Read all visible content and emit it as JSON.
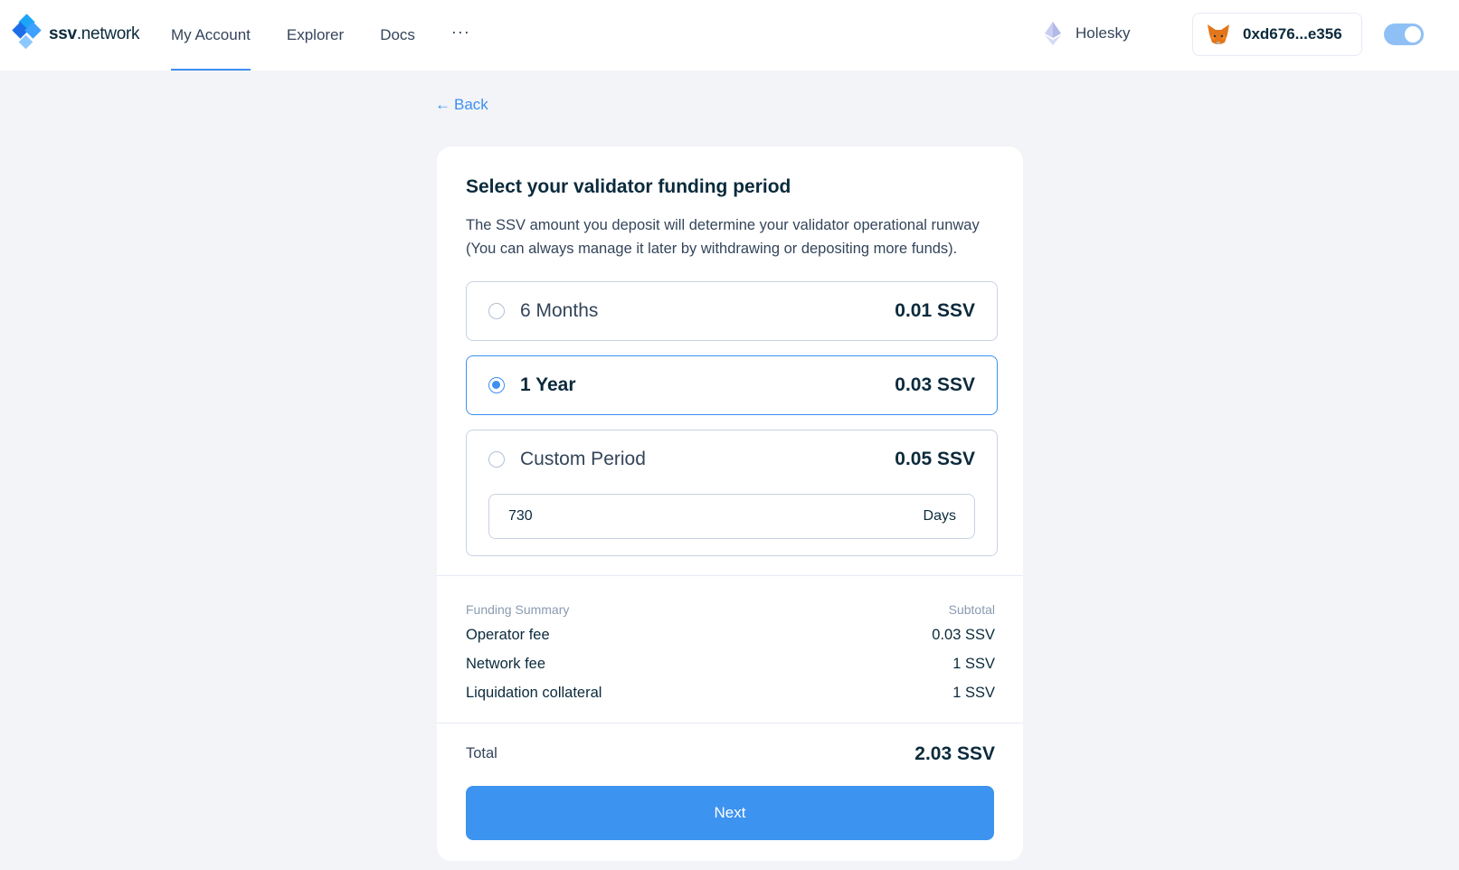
{
  "header": {
    "logo_bold": "ssv",
    "logo_rest": ".network",
    "nav": [
      "My Account",
      "Explorer",
      "Docs"
    ],
    "more": "···",
    "network": "Holesky",
    "wallet_address": "0xd676...e356"
  },
  "back_label": "Back",
  "card": {
    "title": "Select your validator funding period",
    "description": "The SSV amount you deposit will determine your validator operational runway (You can always manage it later by withdrawing or depositing more funds).",
    "options": [
      {
        "label": "6 Months",
        "price": "0.01 SSV",
        "selected": false
      },
      {
        "label": "1 Year",
        "price": "0.03 SSV",
        "selected": true
      },
      {
        "label": "Custom Period",
        "price": "0.05 SSV",
        "selected": false
      }
    ],
    "custom_days_value": "730",
    "custom_days_unit": "Days",
    "summary": {
      "heading": "Funding Summary",
      "subtotal_heading": "Subtotal",
      "rows": [
        {
          "label": "Operator fee",
          "value": "0.03 SSV"
        },
        {
          "label": "Network fee",
          "value": "1 SSV"
        },
        {
          "label": "Liquidation collateral",
          "value": "1 SSV"
        }
      ]
    },
    "total_label": "Total",
    "total_value": "2.03 SSV",
    "next_label": "Next"
  },
  "colors": {
    "accent": "#3d8ff0",
    "background": "#f2f4f7",
    "text": "#0b2a3c"
  }
}
